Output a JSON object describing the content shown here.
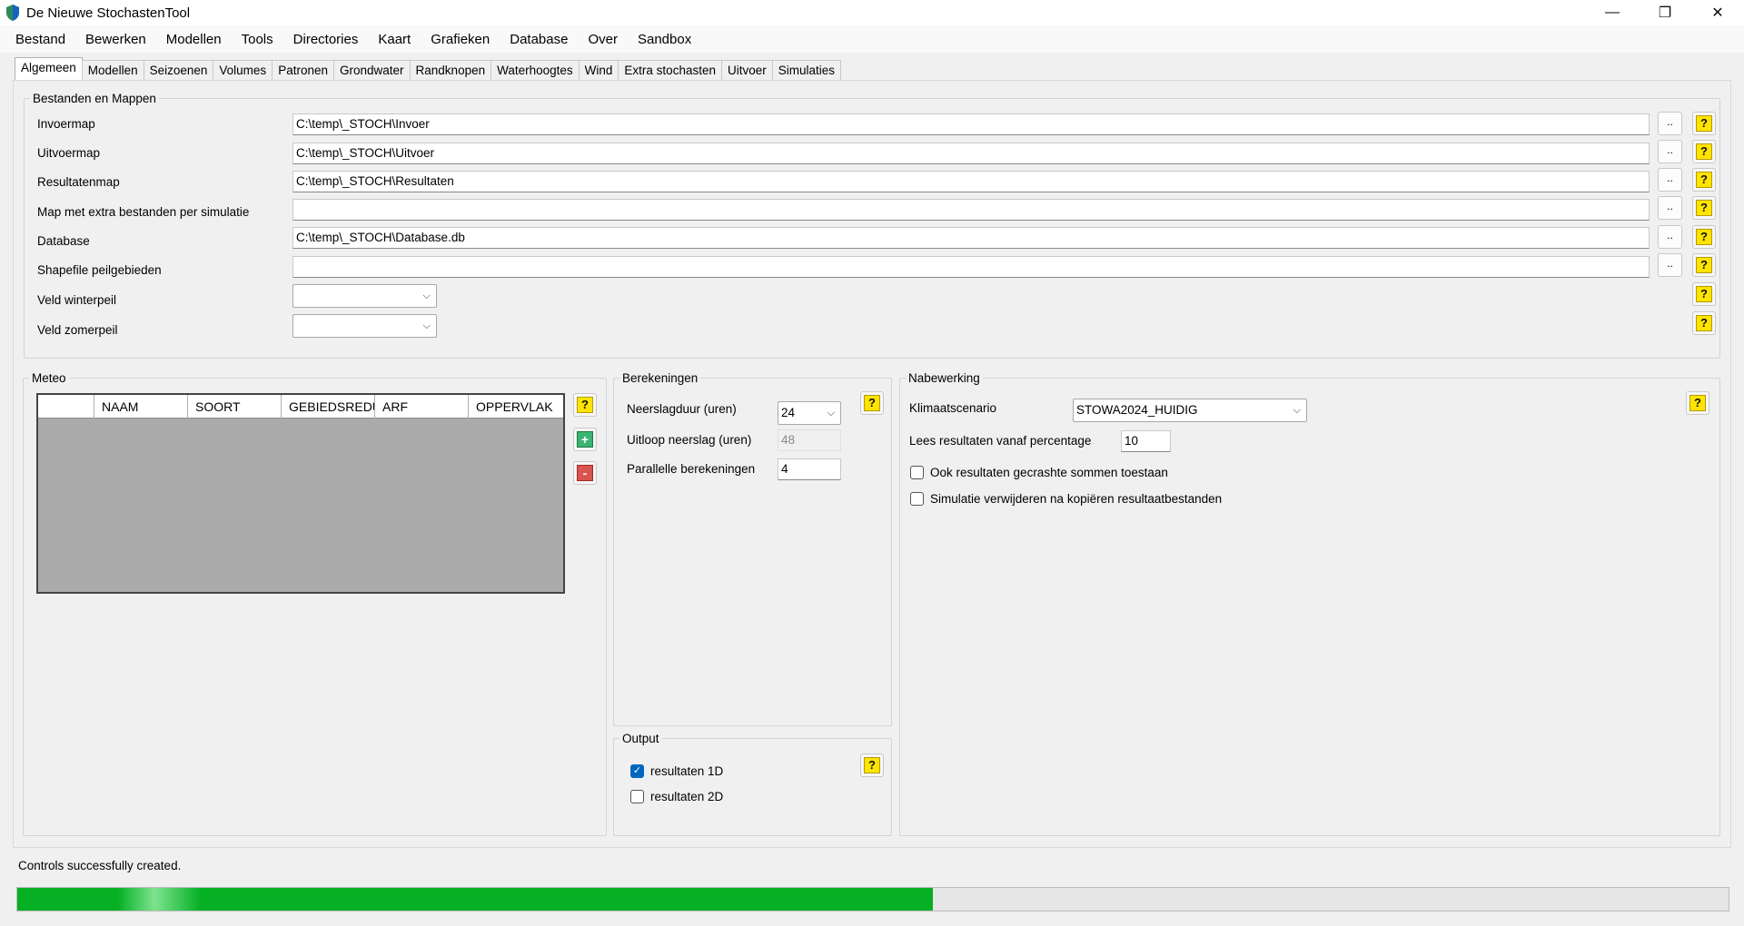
{
  "window": {
    "title": "De Nieuwe StochastenTool",
    "minimize": "—",
    "restore": "❐",
    "close": "✕"
  },
  "menu": [
    "Bestand",
    "Bewerken",
    "Modellen",
    "Tools",
    "Directories",
    "Kaart",
    "Grafieken",
    "Database",
    "Over",
    "Sandbox"
  ],
  "tabs": [
    "Algemeen",
    "Modellen",
    "Seizoenen",
    "Volumes",
    "Patronen",
    "Grondwater",
    "Randknopen",
    "Waterhoogtes",
    "Wind",
    "Extra stochasten",
    "Uitvoer",
    "Simulaties"
  ],
  "active_tab": "Algemeen",
  "files": {
    "legend": "Bestanden en Mappen",
    "browse_label": "..",
    "help_label": "?",
    "rows": [
      {
        "label": "Invoermap",
        "value": "C:\\temp\\_STOCH\\Invoer"
      },
      {
        "label": "Uitvoermap",
        "value": "C:\\temp\\_STOCH\\Uitvoer"
      },
      {
        "label": "Resultatenmap",
        "value": "C:\\temp\\_STOCH\\Resultaten"
      },
      {
        "label": "Map met extra bestanden per simulatie",
        "value": ""
      },
      {
        "label": "Database",
        "value": "C:\\temp\\_STOCH\\Database.db"
      },
      {
        "label": "Shapefile peilgebieden",
        "value": ""
      }
    ],
    "veld_winterpeil": {
      "label": "Veld winterpeil",
      "value": ""
    },
    "veld_zomerpeil": {
      "label": "Veld zomerpeil",
      "value": ""
    }
  },
  "meteo": {
    "legend": "Meteo",
    "columns": [
      "",
      "NAAM",
      "SOORT",
      "GEBIEDSREDUCTIE",
      "ARF",
      "OPPERVLAK"
    ],
    "add_label": "+",
    "remove_label": "-",
    "help_label": "?"
  },
  "berekeningen": {
    "legend": "Berekeningen",
    "help_label": "?",
    "neerslagduur": {
      "label": "Neerslagduur (uren)",
      "value": "24"
    },
    "uitloop": {
      "label": "Uitloop neerslag (uren)",
      "value": "48"
    },
    "parallel": {
      "label": "Parallelle berekeningen",
      "value": "4"
    }
  },
  "output": {
    "legend": "Output",
    "help_label": "?",
    "resultaten_1d": {
      "label": "resultaten 1D",
      "checked": true,
      "mark": "✓"
    },
    "resultaten_2d": {
      "label": "resultaten 2D",
      "checked": false
    }
  },
  "nabewerking": {
    "legend": "Nabewerking",
    "help_label": "?",
    "klimaatscenario": {
      "label": "Klimaatscenario",
      "value": "STOWA2024_HUIDIG"
    },
    "percentage": {
      "label": "Lees resultaten vanaf percentage",
      "value": "10"
    },
    "gecrashte": {
      "label": "Ook resultaten gecrashte sommen toestaan",
      "checked": false
    },
    "verwijderen": {
      "label": "Simulatie verwijderen na kopiëren resultaatbestanden",
      "checked": false
    }
  },
  "status": {
    "text": "Controls successfully created.",
    "progress": 0.535
  },
  "colors": {
    "help_yellow": "#ffe400",
    "add_green": "#3cb371",
    "remove_red": "#d9534f",
    "progress_green": "#06b025",
    "check_blue": "#0067c0",
    "grid_gray": "#ababab"
  }
}
